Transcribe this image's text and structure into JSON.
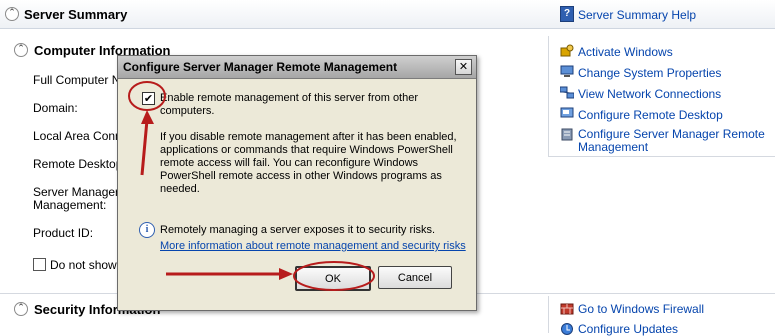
{
  "server_summary": {
    "title": "Server Summary",
    "help_link": "Server Summary Help"
  },
  "computer_info": {
    "title": "Computer Information",
    "labels": [
      "Full Computer Nar",
      "Domain:",
      "Local Area Conne",
      "Remote Desktop:",
      "Server Manager R",
      "Management:",
      "Product ID:"
    ],
    "do_not_show": "Do not show n",
    "tasks": [
      {
        "label": "Activate Windows",
        "icon": "activate-icon"
      },
      {
        "label": "Change System Properties",
        "icon": "computer-icon"
      },
      {
        "label": "View Network Connections",
        "icon": "network-icon"
      },
      {
        "label": "Configure Remote Desktop",
        "icon": "remote-desktop-icon"
      },
      {
        "label": "Configure Server Manager Remote",
        "label2": "Management",
        "icon": "server-manager-icon"
      }
    ]
  },
  "security_info": {
    "title": "Security Information",
    "tasks": [
      {
        "label": "Go to Windows Firewall",
        "icon": "firewall-icon"
      },
      {
        "label": "Configure Updates",
        "icon": "updates-icon"
      }
    ]
  },
  "dialog": {
    "title": "Configure Server Manager Remote Management",
    "close": "✕",
    "checkbox_checked": true,
    "checkbox_label_line1": "Enable remote management of this server from other",
    "checkbox_label_line2": "computers.",
    "description_lines": [
      "If you disable remote management after it has been enabled,",
      "applications or commands that require Windows PowerShell",
      "remote access will fail. You can reconfigure Windows",
      "PowerShell remote access in other Windows programs as",
      "needed."
    ],
    "info_text": "Remotely managing a server exposes it to security risks.",
    "info_link": "More information about remote management and security risks",
    "ok": "OK",
    "cancel": "Cancel"
  },
  "colors": {
    "link": "#0645ad",
    "annotation": "#b71c1c",
    "dialog_bg": "#ece9d8"
  }
}
